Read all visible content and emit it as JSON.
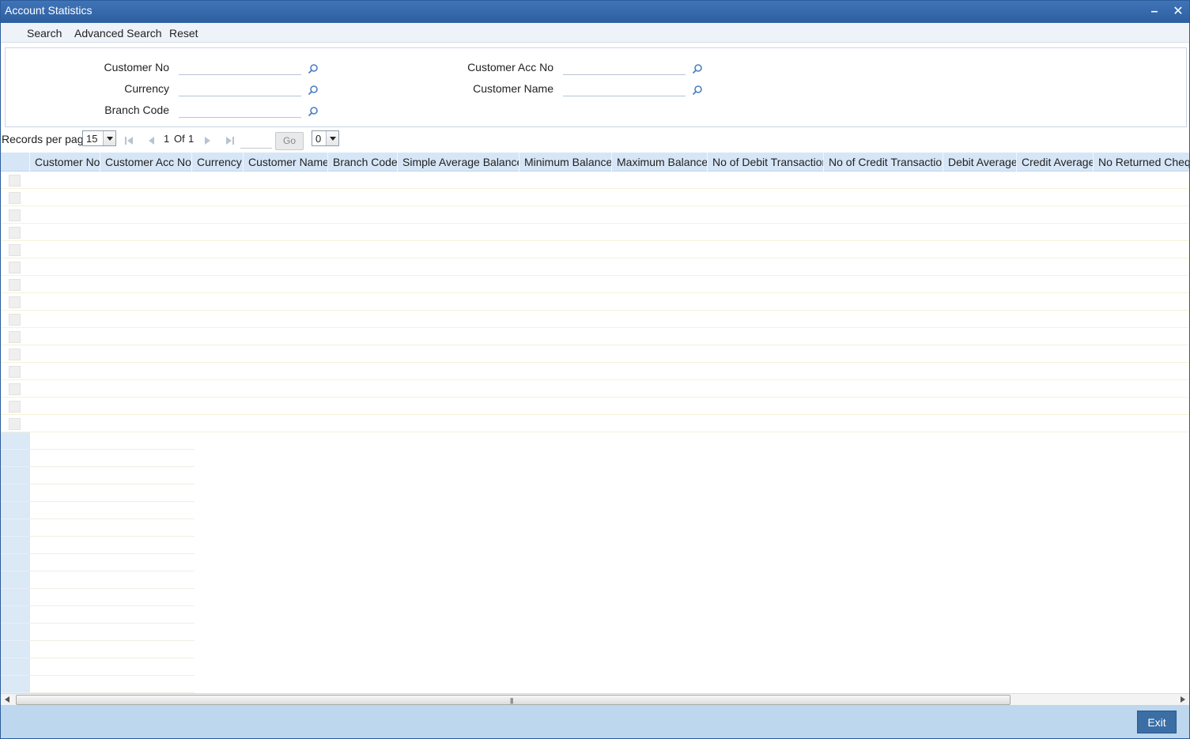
{
  "window": {
    "title": "Account Statistics",
    "minimize_label": "–",
    "close_label": "✕"
  },
  "toolbar": {
    "search": "Search",
    "advanced_search": "Advanced Search",
    "reset": "Reset"
  },
  "search_form": {
    "customer_no": {
      "label": "Customer No",
      "value": ""
    },
    "currency": {
      "label": "Currency",
      "value": ""
    },
    "branch_code": {
      "label": "Branch Code",
      "value": ""
    },
    "customer_acc_no": {
      "label": "Customer Acc No",
      "value": ""
    },
    "customer_name": {
      "label": "Customer Name",
      "value": ""
    }
  },
  "pager": {
    "records_per_page_label": "Records per page",
    "records_per_page_value": "15",
    "current_page": "1",
    "of_label": "Of",
    "total_pages": "1",
    "go_label": "Go",
    "second_select_value": "0"
  },
  "grid": {
    "columns": [
      "Customer No",
      "Customer Acc No",
      "Currency",
      "Customer Name",
      "Branch Code",
      "Simple Average Balance",
      "Minimum Balance",
      "Maximum Balance",
      "No of Debit Transaction",
      "No of Credit Transaction",
      "Debit Average",
      "Credit Average",
      "No Returned Cheque"
    ],
    "row_count": 15
  },
  "footer": {
    "exit_label": "Exit"
  },
  "colors": {
    "titlebar": "#2d5f9f",
    "toolbar_bg": "#eef3fa",
    "grid_header": "#d6e6f7",
    "footer_bg": "#bdd7ee",
    "exit_button": "#3a6ea5"
  }
}
